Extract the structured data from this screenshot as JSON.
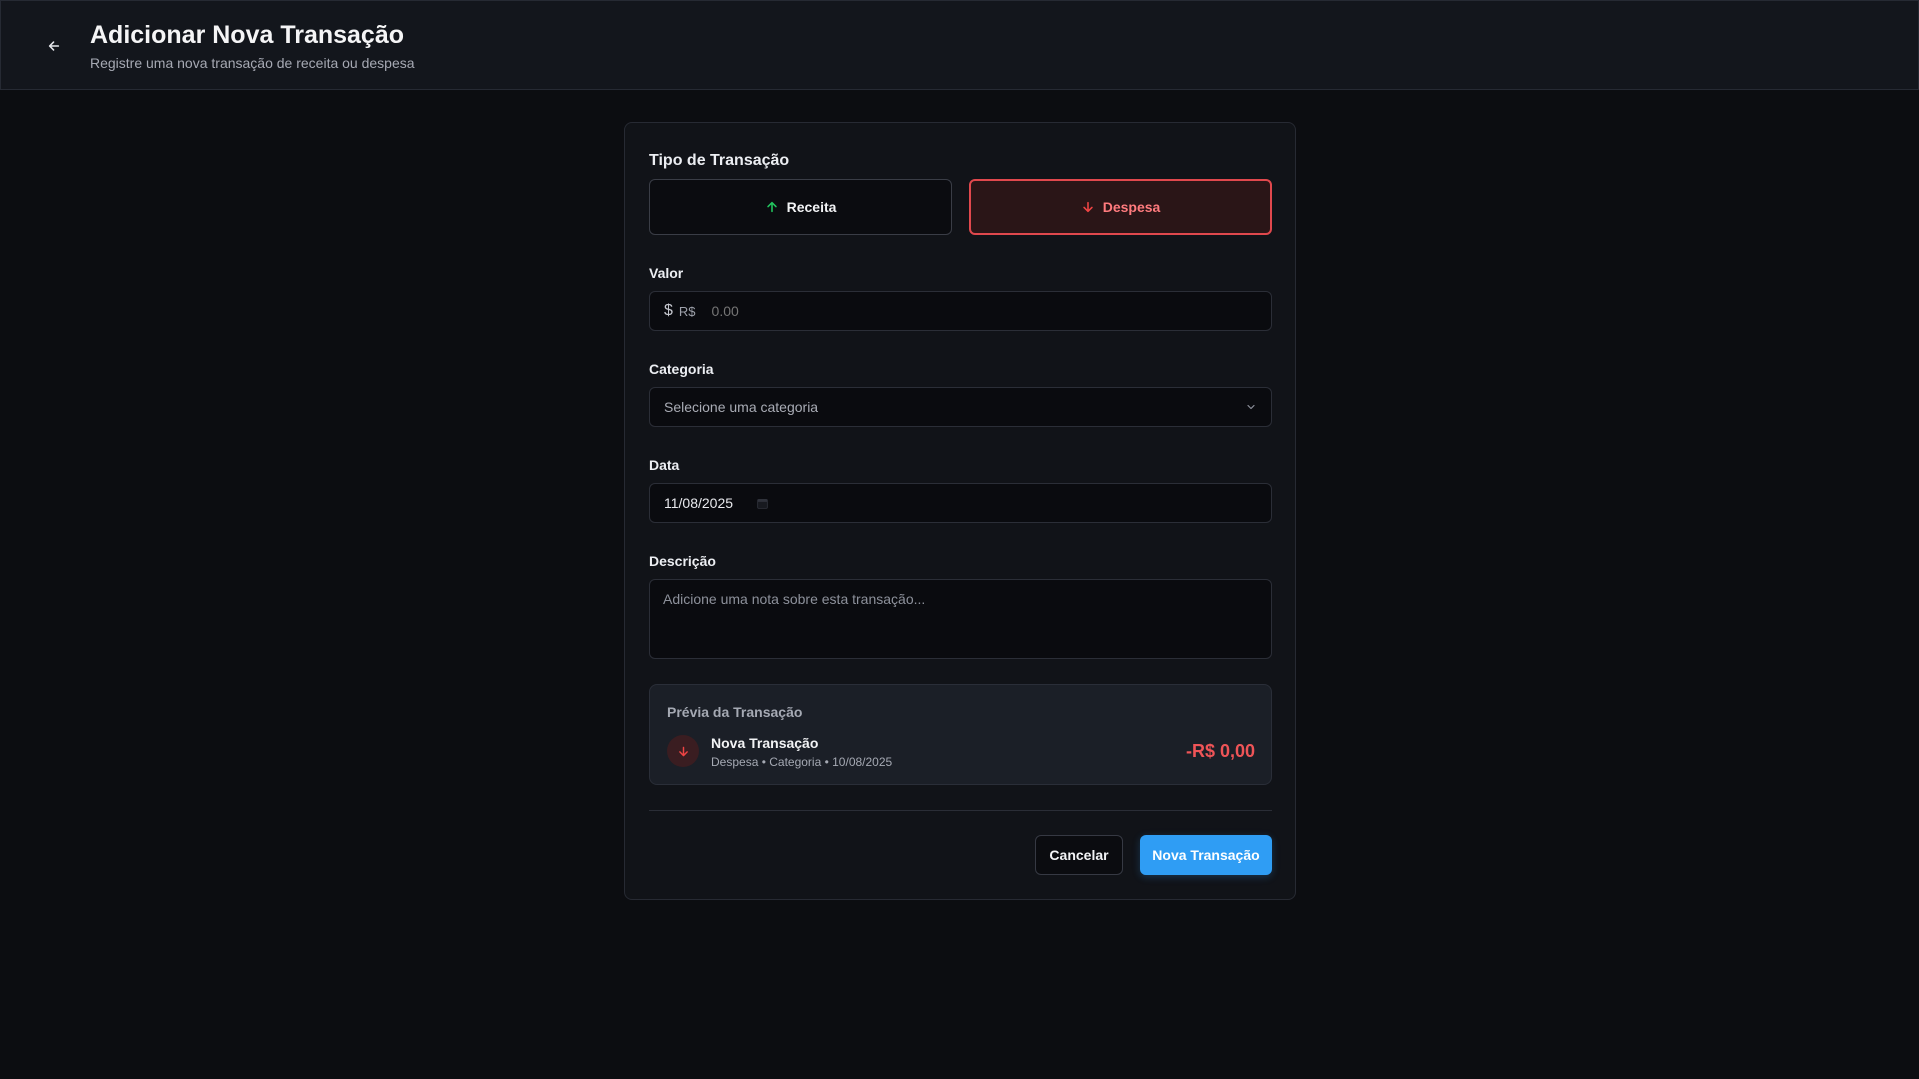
{
  "header": {
    "title": "Adicionar Nova Transação",
    "subtitle": "Registre uma nova transação de receita ou despesa"
  },
  "form": {
    "type_section_title": "Tipo de Transação",
    "type_options": [
      {
        "label": "Receita",
        "icon": "arrow-up-icon",
        "color": "#22c55e",
        "selected": false
      },
      {
        "label": "Despesa",
        "icon": "arrow-down-icon",
        "color": "#ef4444",
        "selected": true
      }
    ],
    "valor": {
      "label": "Valor",
      "prefix": "R$",
      "placeholder": "0.00",
      "value": ""
    },
    "categoria": {
      "label": "Categoria",
      "placeholder": "Selecione uma categoria"
    },
    "data": {
      "label": "Data",
      "value": "11/08/2025"
    },
    "descricao": {
      "label": "Descrição",
      "placeholder": "Adicione uma nota sobre esta transação..."
    }
  },
  "preview": {
    "title": "Prévia da Transação",
    "name": "Nova Transação",
    "meta": "Despesa • Categoria • 10/08/2025",
    "amount": "-R$ 0,00"
  },
  "actions": {
    "cancel_label": "Cancelar",
    "submit_label": "Nova Transação"
  },
  "colors": {
    "accent": "#2f9df4",
    "expense": "#ef4444",
    "income": "#22c55e"
  }
}
